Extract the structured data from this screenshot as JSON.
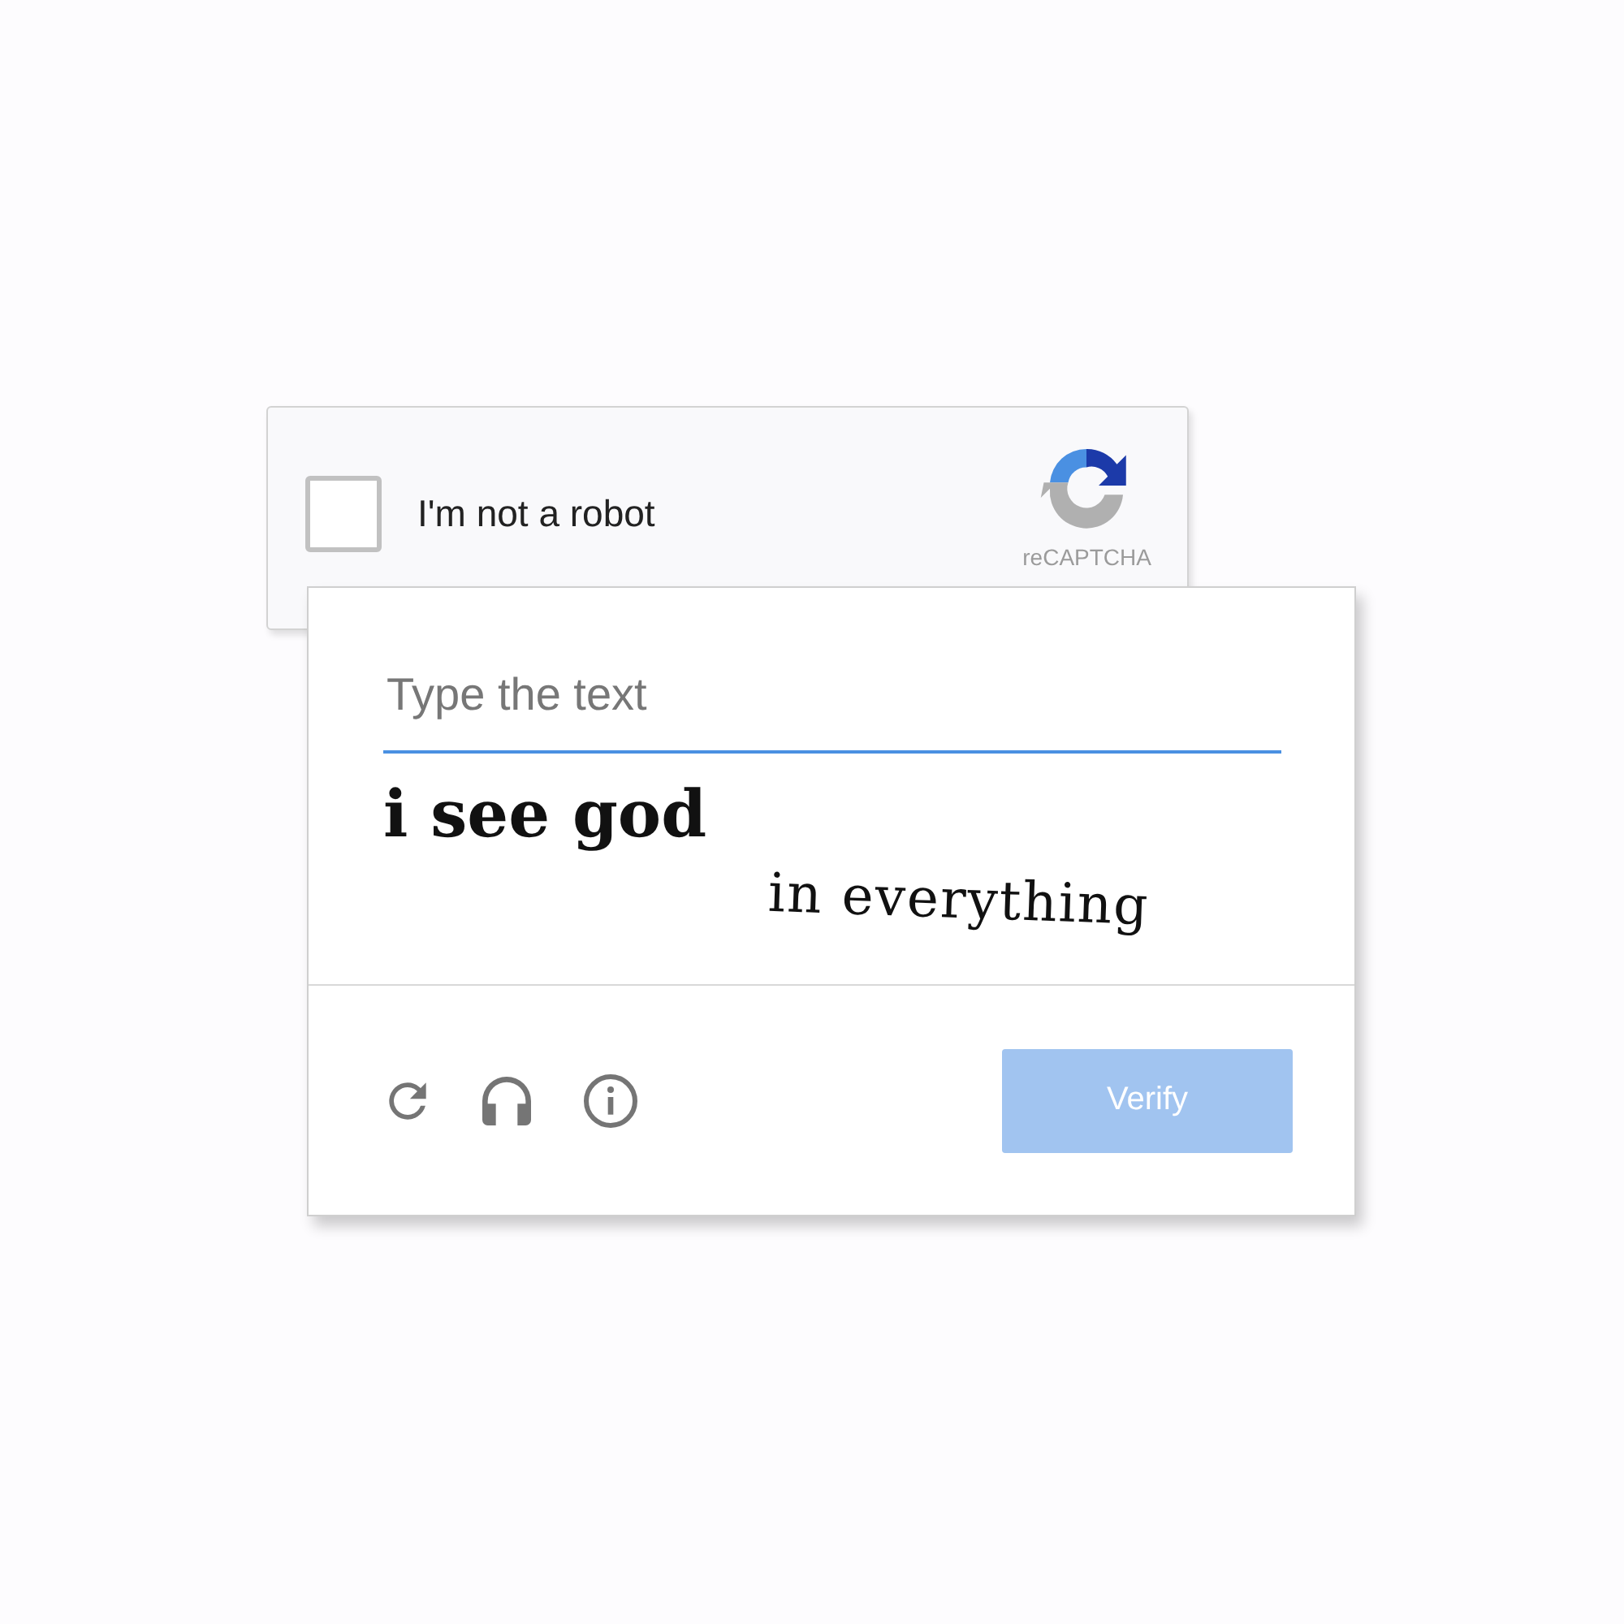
{
  "widget": {
    "checkbox": {
      "label": "I'm not a robot",
      "checked": false
    },
    "brand": "reCAPTCHA"
  },
  "challenge": {
    "input": {
      "placeholder": "Type the text"
    },
    "captcha_lines": [
      "i see god",
      "in everything"
    ],
    "verify_button": {
      "label": "Verify",
      "disabled": true
    }
  }
}
